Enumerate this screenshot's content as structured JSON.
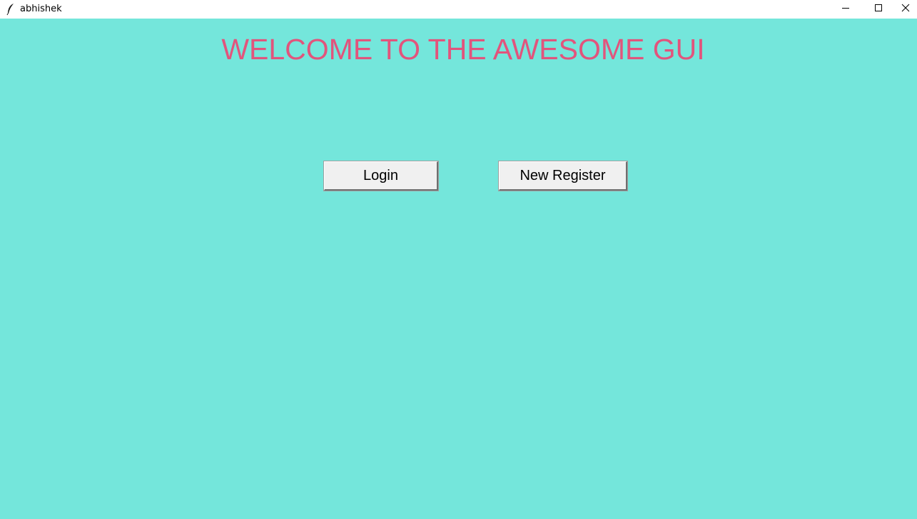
{
  "window": {
    "title": "abhishek",
    "icons": {
      "app": "feather-icon",
      "minimize": "minimize-icon",
      "maximize": "maximize-icon",
      "close": "close-icon"
    }
  },
  "main": {
    "heading": "WELCOME TO THE AWESOME GUI",
    "login_label": "Login",
    "register_label": "New Register"
  },
  "colors": {
    "background": "#74e6db",
    "heading": "#e2547c",
    "button_face": "#f0f0f0"
  }
}
